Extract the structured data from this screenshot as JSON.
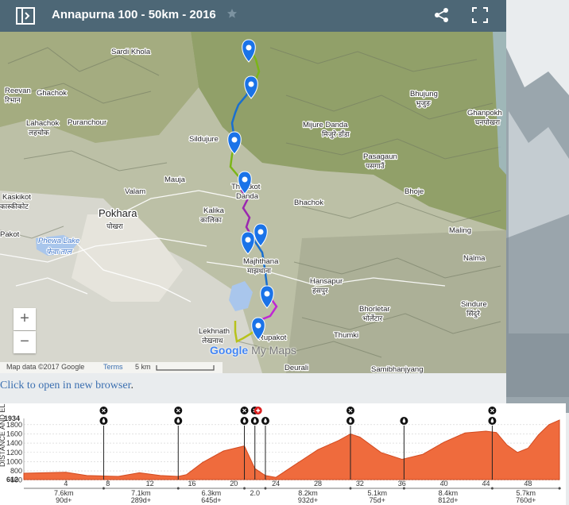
{
  "header": {
    "title": "Annapurna 100 - 50km - 2016"
  },
  "map": {
    "zoom_in": "+",
    "zoom_out": "−",
    "attribution": "Map data ©2017 Google",
    "terms": "Terms",
    "scale": "5 km",
    "brand_google": "Google",
    "brand_mymaps": "My Maps",
    "places": [
      {
        "name": "Sardi Khola",
        "dev": ""
      },
      {
        "name": "Reevan",
        "dev": "रिभान"
      },
      {
        "name": "Ghachok",
        "dev": ""
      },
      {
        "name": "Lahachok",
        "dev": "लहचोक"
      },
      {
        "name": "Puranchour",
        "dev": ""
      },
      {
        "name": "Sildujure",
        "dev": ""
      },
      {
        "name": "Bhujung",
        "dev": "भुजुङ"
      },
      {
        "name": "Ghanpokhara",
        "dev": "घनपोखरा"
      },
      {
        "name": "Mijure Danda",
        "dev": "मिजुरे डाँडा"
      },
      {
        "name": "Pasagaun",
        "dev": "पसगाउँ"
      },
      {
        "name": "Kaskikot",
        "dev": "कास्कीकोट"
      },
      {
        "name": "Valam",
        "dev": ""
      },
      {
        "name": "Mauja",
        "dev": ""
      },
      {
        "name": "Thulakot Danda",
        "dev": ""
      },
      {
        "name": "Bhachok",
        "dev": ""
      },
      {
        "name": "Bhoje",
        "dev": ""
      },
      {
        "name": "Pokhara",
        "dev": "पोखरा"
      },
      {
        "name": "Kalika",
        "dev": "कालिका"
      },
      {
        "name": "Maling",
        "dev": ""
      },
      {
        "name": "Phewa Lake",
        "dev": "फेवा ताल"
      },
      {
        "name": "Majhthana",
        "dev": "माझथाना"
      },
      {
        "name": "Nalma",
        "dev": ""
      },
      {
        "name": "Hansapur",
        "dev": "हंसपुर"
      },
      {
        "name": "Bhorletar",
        "dev": "भोर्लेटार"
      },
      {
        "name": "Sindure",
        "dev": "सिंदुरे"
      },
      {
        "name": "Lekhnath",
        "dev": "लेखनाथ"
      },
      {
        "name": "Rupakot",
        "dev": ""
      },
      {
        "name": "Thumki",
        "dev": ""
      },
      {
        "name": "Deurali",
        "dev": ""
      },
      {
        "name": "Samibhanjyang",
        "dev": ""
      },
      {
        "name": "Pakot",
        "dev": ""
      }
    ]
  },
  "link": {
    "text": "Click to open in new browser",
    "suffix": "."
  },
  "profile": {
    "y_max": "1934",
    "y_min": "612",
    "y_axis_label": "DISTANCE AND ELEVATION",
    "y_ticks": [
      "1800",
      "1600",
      "1400",
      "1200",
      "1000",
      "800",
      "600"
    ],
    "x_ticks": [
      "4",
      "8",
      "12",
      "16",
      "20",
      "24",
      "28",
      "32",
      "36",
      "40",
      "44",
      "48"
    ],
    "segments": [
      {
        "km": "7.6km",
        "gain": "90d+"
      },
      {
        "km": "7.1km",
        "gain": "289d+"
      },
      {
        "km": "6.3km",
        "gain": "645d+"
      },
      {
        "km": "2.0",
        "gain": ""
      },
      {
        "km": "8.2km",
        "gain": "932d+"
      },
      {
        "km": "5.1km",
        "gain": "75d+"
      },
      {
        "km": "8.4km",
        "gain": "812d+"
      },
      {
        "km": "5.7km",
        "gain": "760d+"
      }
    ],
    "colors": {
      "fill": "#ef6b3d",
      "stroke": "#d24a1f"
    }
  },
  "chart_data": {
    "type": "area",
    "title": "",
    "xlabel": "",
    "ylabel": "",
    "ylim": [
      612,
      1934
    ],
    "xlim": [
      0,
      51
    ],
    "x": [
      0,
      2,
      4,
      6,
      7.6,
      9,
      11,
      13,
      14.7,
      15.5,
      17,
      19,
      21,
      22,
      23,
      24,
      26,
      28,
      30,
      31.1,
      32,
      34,
      36,
      38,
      40,
      42,
      44,
      45,
      46,
      47,
      48,
      49,
      50,
      51
    ],
    "y": [
      750,
      760,
      770,
      700,
      690,
      680,
      760,
      700,
      680,
      720,
      980,
      1230,
      1340,
      850,
      700,
      660,
      960,
      1260,
      1460,
      1600,
      1530,
      1200,
      1050,
      1160,
      1420,
      1620,
      1660,
      1630,
      1360,
      1200,
      1290,
      1580,
      1800,
      1900
    ]
  }
}
